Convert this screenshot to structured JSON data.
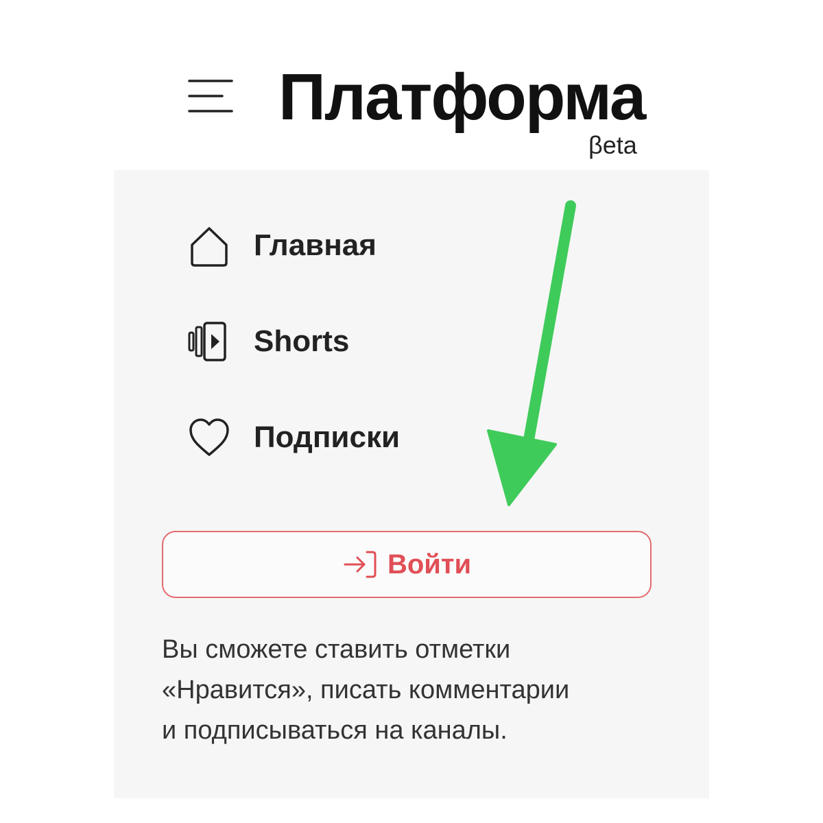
{
  "header": {
    "title": "Платформа",
    "badge": "βeta",
    "menu_icon": "hamburger-menu-icon"
  },
  "nav": {
    "items": [
      {
        "label": "Главная",
        "icon": "home-icon"
      },
      {
        "label": "Shorts",
        "icon": "shorts-icon"
      },
      {
        "label": "Подписки",
        "icon": "heart-icon"
      }
    ]
  },
  "login": {
    "label": "Войти",
    "icon": "login-icon",
    "accent_color": "#e04f56"
  },
  "hint": {
    "lines": [
      "Вы сможете ставить отметки",
      "«Нравится», писать комментарии",
      "и подписываться на каналы."
    ]
  },
  "annotation": {
    "arrow_color": "#3fcb5a",
    "arrow_icon": "arrow-down-icon"
  }
}
